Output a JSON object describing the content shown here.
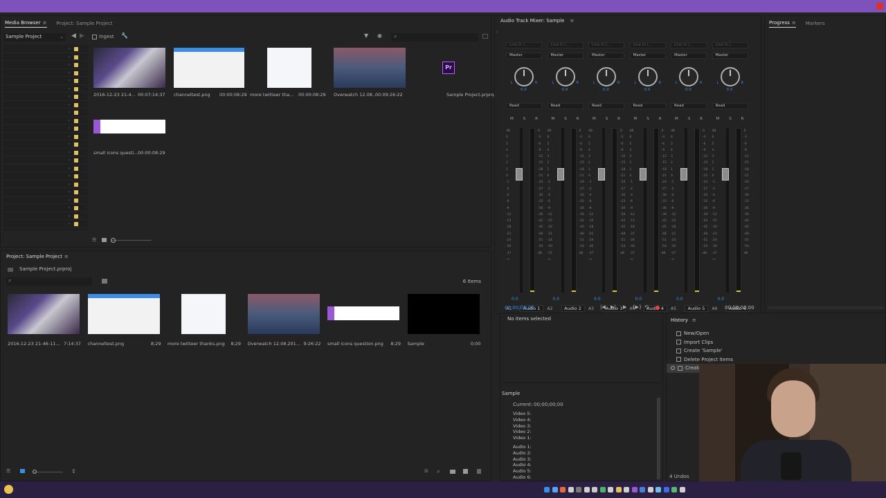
{
  "colors": {
    "accent_blue": "#3a8ee6",
    "top_bar": "#7d52ba",
    "record_red": "#e84545",
    "meter_yellow": "#d9c73a",
    "folder_yellow": "#e2c160"
  },
  "media_browser": {
    "tabs": [
      {
        "label": "Media Browser",
        "active": true
      },
      {
        "label": "Project: Sample Project",
        "active": false
      }
    ],
    "location": "Sample Project",
    "ingest_label": "Ingest",
    "items": [
      {
        "name": "2016-12-23 21-4...",
        "duration": "00:07:14:37",
        "thumb": "screen-dark"
      },
      {
        "name": "channeltest.png",
        "duration": "00:00:08:29",
        "thumb": "web-white"
      },
      {
        "name": "more twitteer tha...",
        "duration": "00:00:08:29",
        "thumb": "tweet"
      },
      {
        "name": "Overwatch 12.08...",
        "duration": "00:09:26:22",
        "thumb": "game"
      },
      {
        "name": "Sample Project.prproj",
        "duration": "",
        "thumb": "premiere",
        "premiere_badge": "Pr"
      },
      {
        "name": "small icons questi...",
        "duration": "00:00:08:29",
        "thumb": "tweet-wide"
      }
    ]
  },
  "project": {
    "title": "Project: Sample Project",
    "file": "Sample Project.prproj",
    "item_count": "6 Items",
    "items": [
      {
        "name": "2016-12-23 21-46-11...",
        "duration": "7:14:37",
        "thumb": "screen-dark"
      },
      {
        "name": "channeltest.png",
        "duration": "8;29",
        "thumb": "web-white"
      },
      {
        "name": "more twitteer thanks.png",
        "duration": "8;29",
        "thumb": "tweet"
      },
      {
        "name": "Overwatch 12.08.201...",
        "duration": "9:26:22",
        "thumb": "game"
      },
      {
        "name": "small icons question.png",
        "duration": "8;29",
        "thumb": "tweet-wide"
      },
      {
        "name": "Sample",
        "duration": "0;00",
        "thumb": "black"
      }
    ]
  },
  "mixer": {
    "title": "Audio Track Mixer: Sample",
    "timecode_left": "00;00;00;00",
    "timecode_right": "00;00;00;00",
    "ticks_left": [
      "dB",
      "6",
      "5",
      "4",
      "3",
      "2",
      "1",
      "0",
      "-1",
      "-2",
      "-4",
      "-6",
      "-9",
      "-12",
      "-15",
      "-18",
      "-21",
      "-24",
      "-30",
      "-37",
      "-∞"
    ],
    "ticks_right": [
      "0",
      "-3",
      "-6",
      "-9",
      "-12",
      "-15",
      "-18",
      "-21",
      "-24",
      "-27",
      "-30",
      "-33",
      "-36",
      "-39",
      "-42",
      "-45",
      "-48",
      "-51",
      "-54",
      "dB"
    ],
    "channels": [
      {
        "id": "A1",
        "name": "Audio 1",
        "input": "Line In (...",
        "output": "Master",
        "mode": "Read",
        "value": "0.0",
        "pan": "0.0"
      },
      {
        "id": "A2",
        "name": "Audio 2",
        "input": "Line In (...",
        "output": "Master",
        "mode": "Read",
        "value": "0.0",
        "pan": "0.0"
      },
      {
        "id": "A3",
        "name": "Audio 3",
        "input": "Line In (...",
        "output": "Master",
        "mode": "Read",
        "value": "0.0",
        "pan": "0.0"
      },
      {
        "id": "A4",
        "name": "Audio 4",
        "input": "Line In (...",
        "output": "Master",
        "mode": "Read",
        "value": "0.0",
        "pan": "0.0"
      },
      {
        "id": "A5",
        "name": "Audio 5",
        "input": "Line In (...",
        "output": "Master",
        "mode": "Read",
        "value": "0.0",
        "pan": "0.0"
      },
      {
        "id": "A6",
        "name": "Audio 6",
        "input": "Line In (...",
        "output": "Master",
        "mode": "Read",
        "value": "0.0",
        "pan": "0.0"
      }
    ],
    "msr": [
      "M",
      "S",
      "R"
    ]
  },
  "progress": {
    "tabs": [
      {
        "label": "Progress",
        "active": true
      },
      {
        "label": "Markers",
        "active": false
      }
    ]
  },
  "info": {
    "no_items": "No items selected",
    "sequence": "Sample",
    "current_label": "Current:",
    "current_value": "00;00;00;00",
    "video_tracks": [
      "Video 5:",
      "Video 4:",
      "Video 3:",
      "Video 2:",
      "Video 1:"
    ],
    "audio_tracks": [
      "Audio 1:",
      "Audio 2:",
      "Audio 3:",
      "Audio 4:",
      "Audio 5:",
      "Audio 6:"
    ]
  },
  "history": {
    "title": "History",
    "items": [
      "New/Open",
      "Import Clips",
      "Create 'Sample'",
      "Delete Project Items",
      "Create"
    ],
    "undos": "4 Undos"
  }
}
